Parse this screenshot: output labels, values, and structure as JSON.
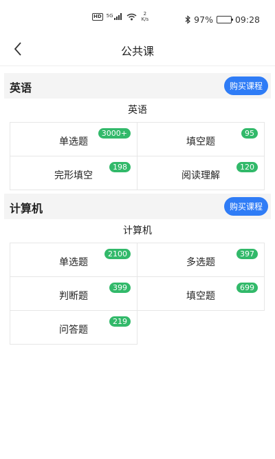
{
  "status_bar": {
    "hd_label": "HD",
    "signal_label": "5G",
    "net_speed_value": "2",
    "net_speed_unit": "K/s",
    "battery": "97%",
    "battery_level": 0.97,
    "time": "09:28"
  },
  "header": {
    "title": "公共课"
  },
  "sections": [
    {
      "title": "英语",
      "buy_label": "购买课程",
      "subtitle": "英语",
      "items": [
        {
          "label": "单选题",
          "count": "3000+"
        },
        {
          "label": "填空题",
          "count": "95"
        },
        {
          "label": "完形填空",
          "count": "198"
        },
        {
          "label": "阅读理解",
          "count": "120"
        }
      ]
    },
    {
      "title": "计算机",
      "buy_label": "购买课程",
      "subtitle": "计算机",
      "items": [
        {
          "label": "单选题",
          "count": "2100"
        },
        {
          "label": "多选题",
          "count": "397"
        },
        {
          "label": "判断题",
          "count": "399"
        },
        {
          "label": "填空题",
          "count": "699"
        },
        {
          "label": "问答题",
          "count": "219"
        }
      ]
    }
  ],
  "colors": {
    "accent": "#2f7cf6",
    "badge": "#32b96a",
    "section_bg": "#f4f4f4"
  }
}
